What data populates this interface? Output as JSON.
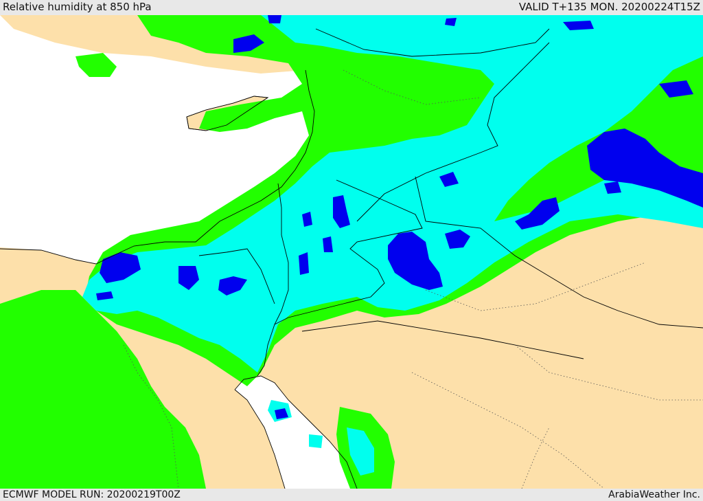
{
  "header": {
    "title": "Relative humidity at 850 hPa",
    "valid": "VALID T+135 MON. 20200224T15Z"
  },
  "footer": {
    "model_run": "ECMWF MODEL RUN: 20200219T00Z",
    "credit": "ArabiaWeather Inc."
  },
  "colors": {
    "sea": "#ffffff",
    "land": "#fde0aa",
    "humidity_low": "#22ff00",
    "humidity_mid": "#00ffee",
    "humidity_high": "#0000ee",
    "border": "#000000"
  }
}
